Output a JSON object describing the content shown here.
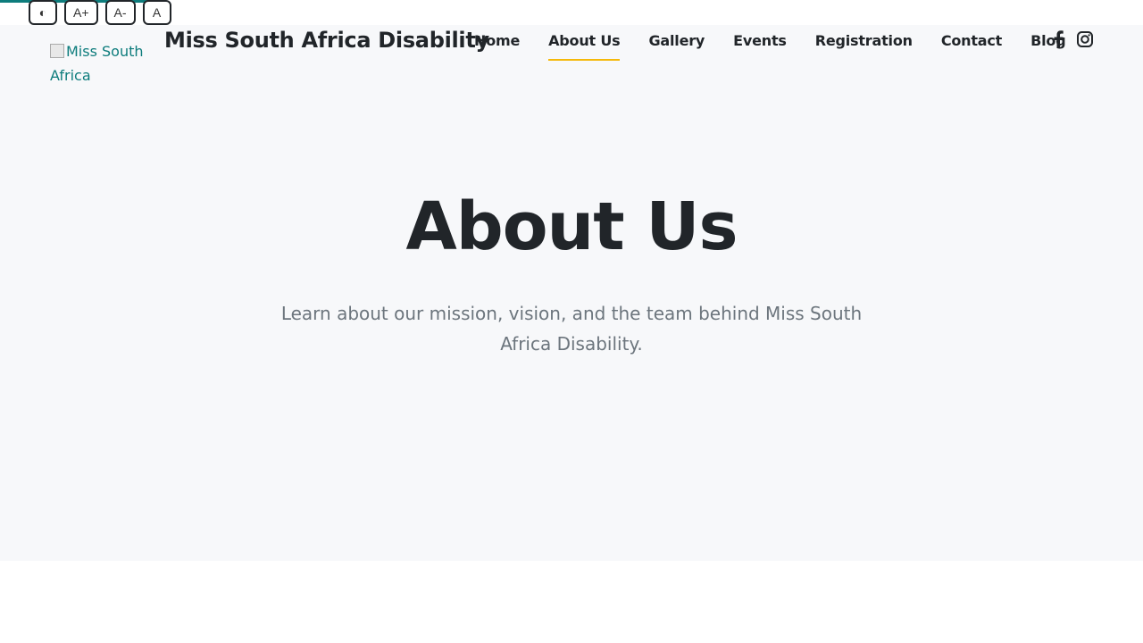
{
  "accessibility": {
    "contrast_label": "◐",
    "increase_label": "A+",
    "decrease_label": "A-",
    "reset_label": "A"
  },
  "header": {
    "logo_alt": "Miss South Africa",
    "site_title": "Miss South Africa Disability",
    "nav": [
      {
        "label": "Home"
      },
      {
        "label": "About Us",
        "active": true
      },
      {
        "label": "Gallery"
      },
      {
        "label": "Events"
      },
      {
        "label": "Registration"
      },
      {
        "label": "Contact"
      },
      {
        "label": "Blog"
      }
    ],
    "social": [
      {
        "icon": "facebook-icon"
      },
      {
        "icon": "instagram-icon"
      }
    ]
  },
  "hero": {
    "title": "About Us",
    "subtitle": "Learn about our mission, vision, and the team behind Miss South Africa Disability."
  },
  "colors": {
    "accent": "#f5b90a",
    "brand": "#0d7c7c",
    "hero_bg": "#f7f8fa",
    "text": "#212529",
    "muted": "#6c757d"
  }
}
